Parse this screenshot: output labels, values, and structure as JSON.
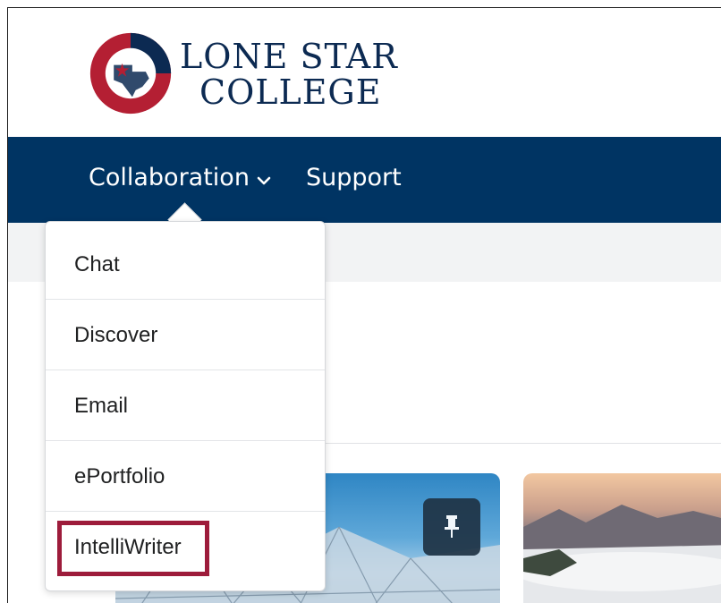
{
  "logo": {
    "line1": "LONE STAR",
    "line2": "COLLEGE",
    "icon": "lone-star-college-seal-icon",
    "colors": {
      "navy": "#0c2a52",
      "red": "#b41f33"
    }
  },
  "nav": {
    "background": "#003463",
    "items": [
      {
        "label": "Collaboration",
        "icon": "chevron-down-icon"
      },
      {
        "label": "Support"
      }
    ]
  },
  "dropdown": {
    "items": [
      {
        "label": "Chat"
      },
      {
        "label": "Discover"
      },
      {
        "label": "Email"
      },
      {
        "label": "ePortfolio"
      },
      {
        "label": "IntelliWriter",
        "highlighted": true
      }
    ],
    "highlight_color": "#9d1c3b"
  },
  "cards": [
    {
      "icon": "pin-icon"
    }
  ]
}
